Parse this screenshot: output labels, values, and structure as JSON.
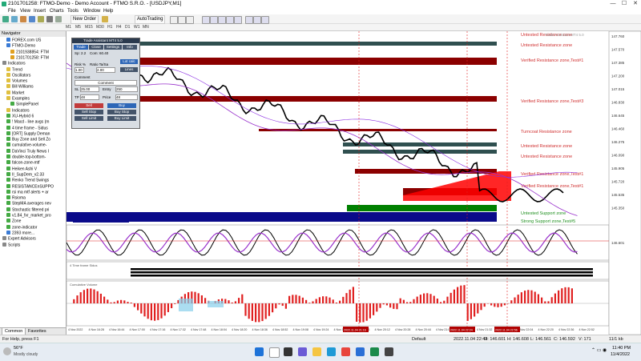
{
  "window": {
    "title": "2101701258: FTMO-Demo - Demo Account - FTMO S.R.O. - [USDJPY,M1]",
    "controls": [
      "—",
      "☐",
      "✕"
    ]
  },
  "menu": [
    "File",
    "View",
    "Insert",
    "Charts",
    "Tools",
    "Window",
    "Help"
  ],
  "toolbar": {
    "new_order": "New Order",
    "autotrading": "AutoTrading"
  },
  "timeframes": [
    "M1",
    "M5",
    "M15",
    "M30",
    "H1",
    "H4",
    "D1",
    "W1",
    "MN"
  ],
  "navigator": {
    "header": "Navigator",
    "items": [
      {
        "label": "FOREX.com US",
        "indent": 1,
        "color": "#3a7bd5"
      },
      {
        "label": "FTMO-Demo",
        "indent": 1,
        "color": "#3a7bd5"
      },
      {
        "label": "2101938854: FTM",
        "indent": 2,
        "color": "#e0a020"
      },
      {
        "label": "2101701258: FTM",
        "indent": 2,
        "color": "#e0a020"
      },
      {
        "label": "Indicators",
        "indent": 0,
        "color": "#888888"
      },
      {
        "label": "Trend",
        "indent": 1,
        "color": "#e0c040"
      },
      {
        "label": "Oscillators",
        "indent": 1,
        "color": "#e0c040"
      },
      {
        "label": "Volumes",
        "indent": 1,
        "color": "#e0c040"
      },
      {
        "label": "Bill Williams",
        "indent": 1,
        "color": "#e0c040"
      },
      {
        "label": "Market",
        "indent": 1,
        "color": "#e0c040"
      },
      {
        "label": "Examples",
        "indent": 1,
        "color": "#e0c040"
      },
      {
        "label": "SimplePanel",
        "indent": 2,
        "color": "#44aa44"
      },
      {
        "label": "Indicators",
        "indent": 1,
        "color": "#e0c040"
      },
      {
        "label": "XU-Hybrid 6",
        "indent": 1,
        "color": "#44aa44"
      },
      {
        "label": "! Macd - line avgs (m",
        "indent": 1,
        "color": "#44aa44"
      },
      {
        "label": "4 time frame - Sidus",
        "indent": 1,
        "color": "#44aa44"
      },
      {
        "label": "[ORT] Supply Deman",
        "indent": 1,
        "color": "#44aa44"
      },
      {
        "label": "Buy Zone and Sell Zo",
        "indent": 1,
        "color": "#44aa44"
      },
      {
        "label": "cumulative-volume-",
        "indent": 1,
        "color": "#44aa44"
      },
      {
        "label": "DaVinci Truly News I",
        "indent": 1,
        "color": "#44aa44"
      },
      {
        "label": "double-top-bottom-",
        "indent": 1,
        "color": "#44aa44"
      },
      {
        "label": "falcon-zone-mtf",
        "indent": 1,
        "color": "#44aa44"
      },
      {
        "label": "Heiken Ashi V",
        "indent": 1,
        "color": "#44aa44"
      },
      {
        "label": "II_SupDem_v2.33",
        "indent": 1,
        "color": "#44aa44"
      },
      {
        "label": "Renko Trend Swings",
        "indent": 1,
        "color": "#44aa44"
      },
      {
        "label": "RESISTANCEnSUPPO",
        "indent": 1,
        "color": "#44aa44"
      },
      {
        "label": "rsi ma mtf alerts + ar",
        "indent": 1,
        "color": "#44aa44"
      },
      {
        "label": "Rsioma",
        "indent": 1,
        "color": "#44aa44"
      },
      {
        "label": "StepMA averages nev",
        "indent": 1,
        "color": "#44aa44"
      },
      {
        "label": "Stochastic filtered pri",
        "indent": 1,
        "color": "#44aa44"
      },
      {
        "label": "v1.84_fxr_market_pro",
        "indent": 1,
        "color": "#44aa44"
      },
      {
        "label": "Zone",
        "indent": 1,
        "color": "#44aa44"
      },
      {
        "label": "zone-indicator",
        "indent": 1,
        "color": "#44aa44"
      },
      {
        "label": "2393 more...",
        "indent": 1,
        "color": "#3a7bd5"
      },
      {
        "label": "Expert Advisors",
        "indent": 0,
        "color": "#888888"
      },
      {
        "label": "Scripts",
        "indent": 0,
        "color": "#888888"
      }
    ],
    "tabs": [
      "Common",
      "Favorites"
    ]
  },
  "trade_panel": {
    "title": "Trade Assistant MT4 5.0",
    "tabs": [
      "Trade",
      "Close",
      "Settings",
      "Info"
    ],
    "row_a": "Sp: 2.2",
    "row_b": "Com: 60.40",
    "lot_calc": "Lot calc",
    "risk_pct": "Risk %",
    "risk_val": "1.00",
    "ratio_label": "Ratio Ta/Sa",
    "ratio_val": "2.00",
    "lines_btn": "Lines",
    "comment_label": "Comment",
    "comment_header": "Comment",
    "sl_label": "SL",
    "sl_val": "25.00",
    "entry_label": "Entry",
    "entry_val": "250",
    "tp_label": "TP",
    "tp_val": "48",
    "price_label": "Price",
    "price_val": "48",
    "sell_btn": "Sell",
    "buy_btn": "Buy",
    "sell_stop": "Sell Stop",
    "buy_stop": "Buy Stop",
    "sell_limit": "Sell Limit",
    "buy_limit": "Buy Limit"
  },
  "chart": {
    "top_right_label": "Trade Assistant MT4 5.0",
    "zones": [
      {
        "label": "Untested Resistance zone",
        "color": "#d03030"
      },
      {
        "label": "Untested Resistance zone",
        "color": "#d03030"
      },
      {
        "label": "Verified Resistance zone,Test#1",
        "color": "#d03030"
      },
      {
        "label": "Verified Resistance zone,Test#3",
        "color": "#d03030"
      },
      {
        "label": "Turncoat Resistance zone",
        "color": "#d03030"
      },
      {
        "label": "Untested Resistance zone",
        "color": "#d03030"
      },
      {
        "label": "Untested Resistance zone",
        "color": "#d03030"
      },
      {
        "label": "Verified Resistance zone,Test#1",
        "color": "#d03030"
      },
      {
        "label": "Verified Resistance zone,Test#1",
        "color": "#d03030"
      },
      {
        "label": "Untested Support zone",
        "color": "#209020"
      },
      {
        "label": "Strong Support zone,Test#5",
        "color": "#209020"
      }
    ],
    "price_ticks": [
      "147.760",
      "147.570",
      "147.385",
      "147.200",
      "147.015",
      "146.830",
      "146.645",
      "146.460",
      "146.275",
      "146.090",
      "145.905",
      "145.720",
      "145.535",
      "145.350"
    ],
    "indicator_price": "146.601",
    "indicator2_label": "4 Time frame Sidus",
    "indicator3_label": "Cumulative Volume",
    "time_labels": [
      "4 Nov 2022",
      "4 Nov 16:28",
      "4 Nov 16:44",
      "4 Nov 17:00",
      "4 Nov 17:16",
      "4 Nov 17:32",
      "4 Nov 17:48",
      "4 Nov 18:04",
      "4 Nov 18:20",
      "4 Nov 18:36",
      "4 Nov 18:52",
      "4 Nov 19:08",
      "4 Nov 19:24",
      "4 Nov 19:40",
      "4 Nov 19:56",
      "4 Nov 20:12",
      "4 Nov 20:28",
      "4 Nov 20:44",
      "4 Nov 21:00",
      "4 Nov 21:16",
      "4 Nov 21:32",
      "4 Nov 21:48",
      "4 Nov 22:04",
      "4 Nov 22:20",
      "4 Nov 22:36",
      "4 Nov 22:52"
    ],
    "time_highlights": [
      "2022.11.04 21:16",
      "2022.11.04 22:24",
      "2022.11.04 22:56"
    ]
  },
  "statusbar": {
    "help": "For Help, press F1",
    "profile": "Default",
    "datetime": "2022.11.04 22:44",
    "open": "O: 146.601",
    "high": "H: 146.608",
    "low": "L: 146.561",
    "close": "C: 146.592",
    "volume": "V: 171",
    "traffic": "11/1 kb"
  },
  "taskbar": {
    "weather_temp": "56°F",
    "weather_desc": "Mostly cloudy",
    "time": "11:40 PM",
    "date": "11/4/2022"
  }
}
